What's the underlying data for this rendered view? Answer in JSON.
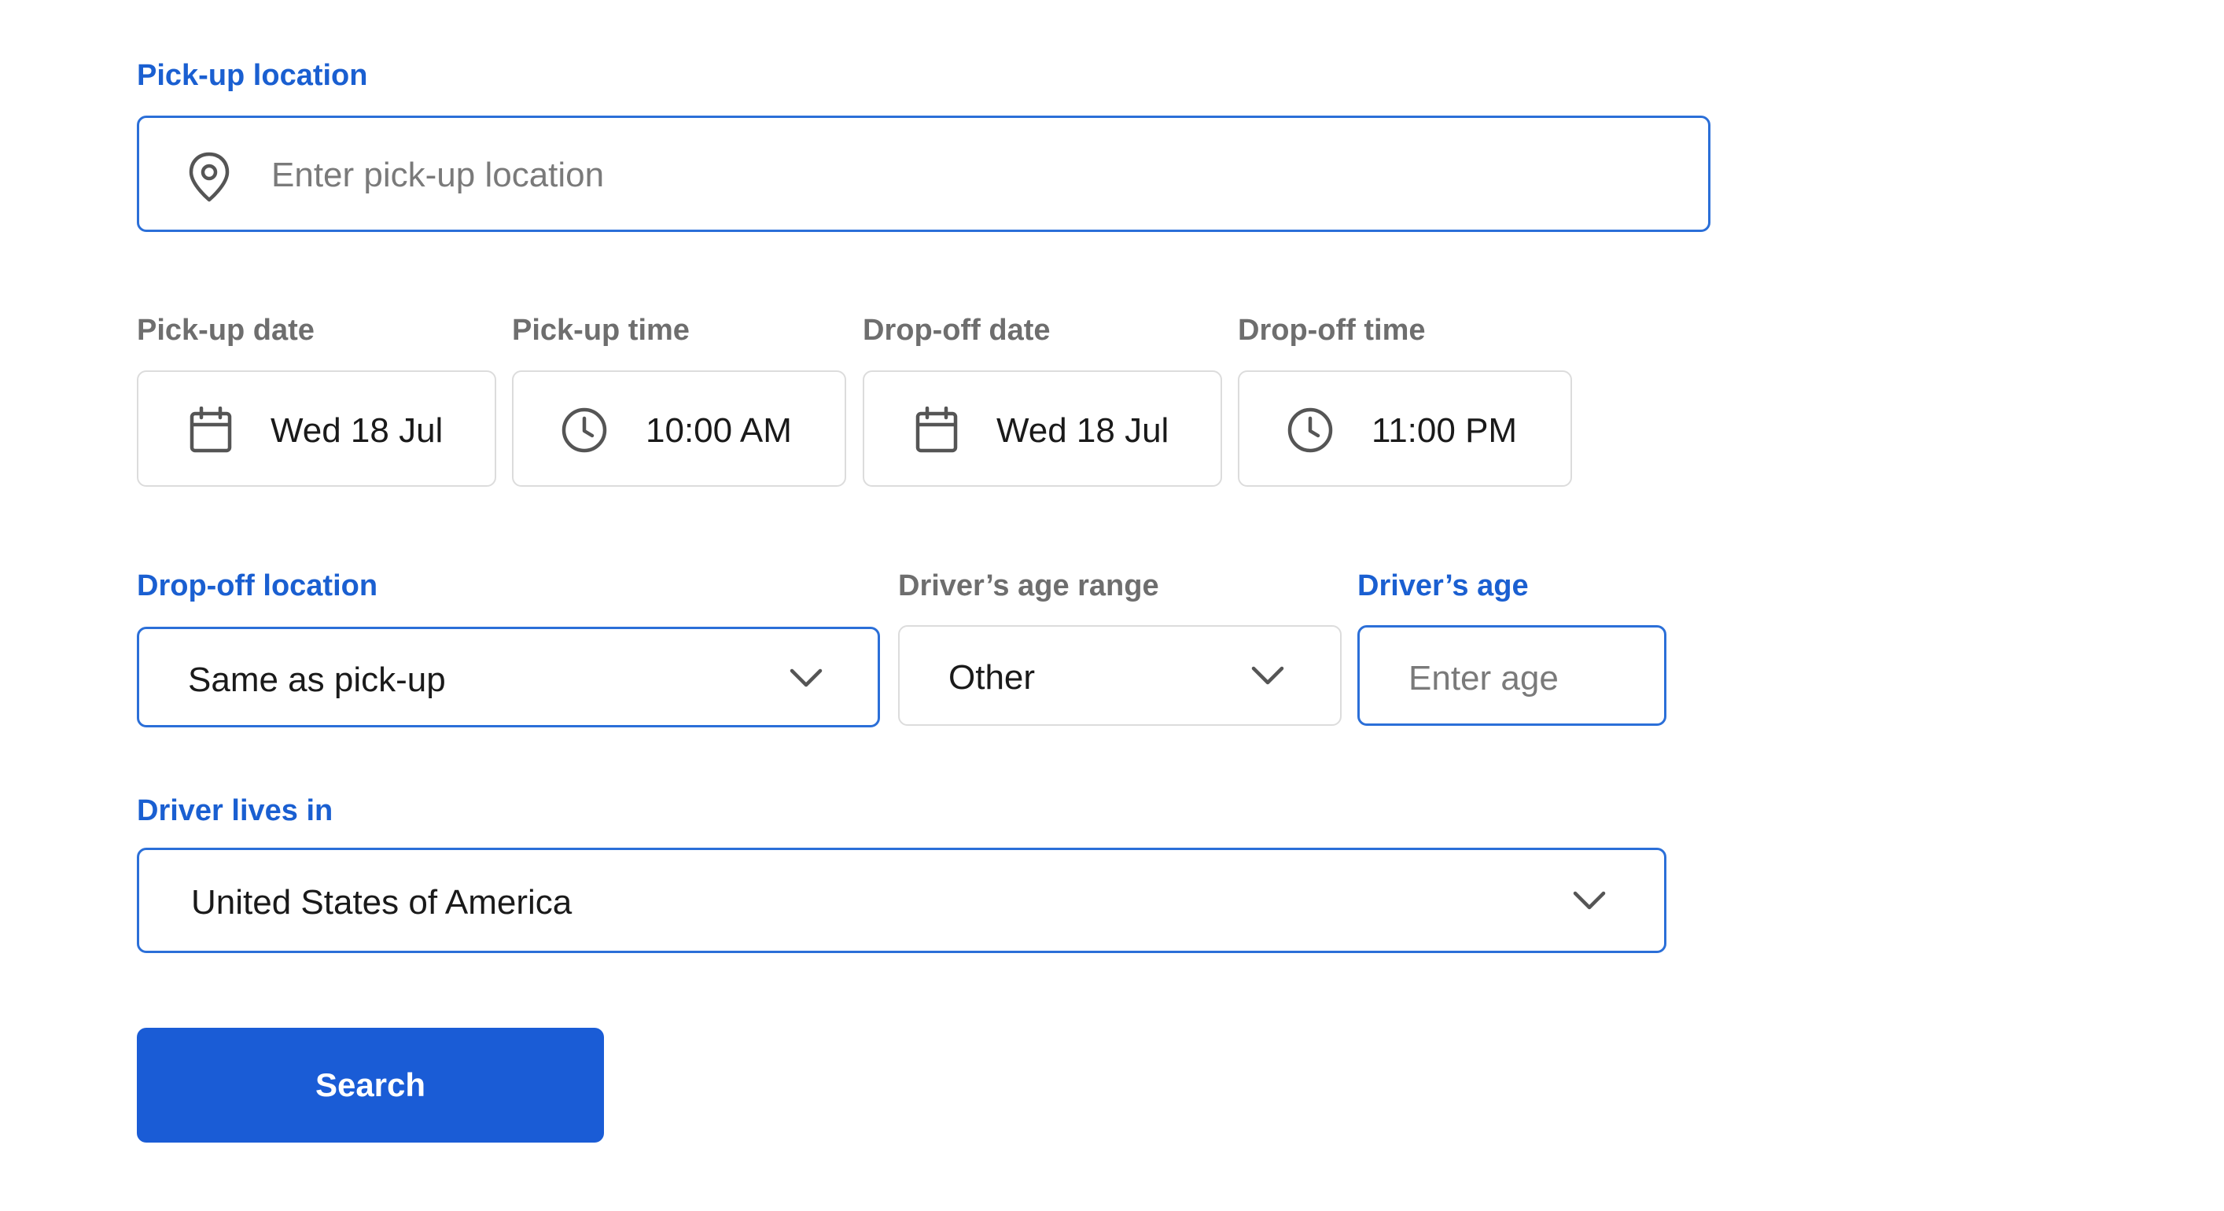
{
  "pickup_location": {
    "label": "Pick-up location",
    "placeholder": "Enter pick-up location",
    "icon": "map-pin-icon"
  },
  "pickup_date": {
    "label": "Pick-up date",
    "value": "Wed 18 Jul",
    "icon": "calendar-icon"
  },
  "pickup_time": {
    "label": "Pick-up time",
    "value": "10:00 AM",
    "icon": "clock-icon"
  },
  "dropoff_date": {
    "label": "Drop-off date",
    "value": "Wed 18 Jul",
    "icon": "calendar-icon"
  },
  "dropoff_time": {
    "label": "Drop-off time",
    "value": "11:00 PM",
    "icon": "clock-icon"
  },
  "dropoff_location": {
    "label": "Drop-off location",
    "value": "Same as pick-up"
  },
  "age_range": {
    "label": "Driver’s age range",
    "value": "Other"
  },
  "driver_age": {
    "label": "Driver’s age",
    "placeholder": "Enter age"
  },
  "residence": {
    "label": "Driver lives in",
    "value": "United States of America"
  },
  "search": {
    "label": "Search"
  },
  "colors": {
    "accent": "#1a5fd1",
    "focus_border": "#2b6fd8",
    "button": "#1a5cd6",
    "muted_label": "#6e6e6e",
    "plain_border": "#dcdcdc"
  }
}
